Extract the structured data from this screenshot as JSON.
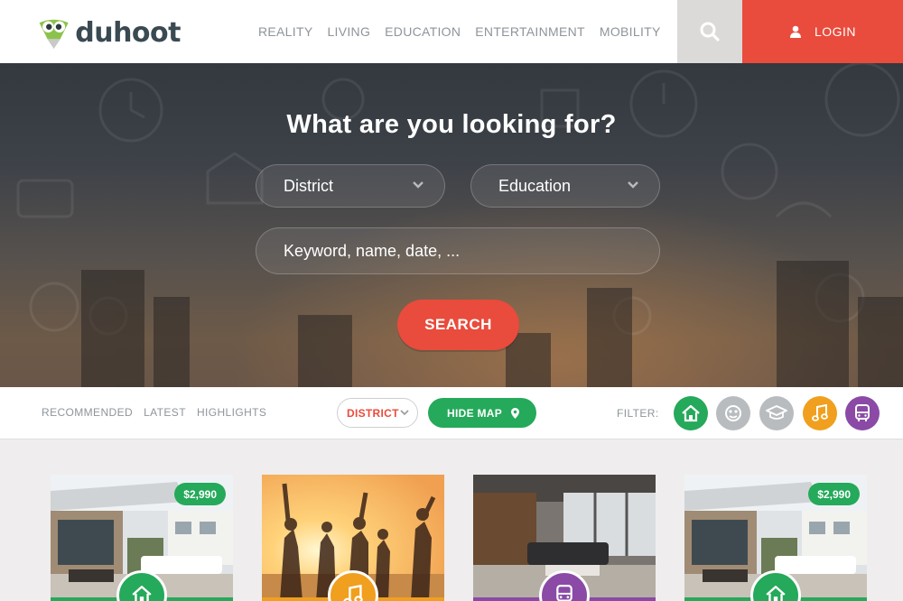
{
  "brand": {
    "name": "duhoot"
  },
  "nav": {
    "items": [
      "REALITY",
      "LIVING",
      "EDUCATION",
      "ENTERTAINMENT",
      "MOBILITY"
    ],
    "login_label": "LOGIN"
  },
  "hero": {
    "title": "What are you looking for?",
    "district_select": "District",
    "category_select": "Education",
    "keyword_placeholder": "Keyword, name, date, ...",
    "search_label": "SEARCH"
  },
  "filterbar": {
    "tabs": [
      "RECOMMENDED",
      "LATEST",
      "HIGHLIGHTS"
    ],
    "district_label": "DISTRICT",
    "hide_map_label": "HIDE MAP",
    "filter_label": "FILTER:",
    "filters": [
      {
        "icon": "home-icon",
        "color": "#25a95a",
        "active": true
      },
      {
        "icon": "mask-icon",
        "color": "#b8bcbf",
        "active": false
      },
      {
        "icon": "graduation-cap-icon",
        "color": "#b8bcbf",
        "active": false
      },
      {
        "icon": "music-note-icon",
        "color": "#f0a01e",
        "active": true
      },
      {
        "icon": "bus-icon",
        "color": "#8a4aa6",
        "active": true
      }
    ]
  },
  "cards": [
    {
      "category": "reality",
      "price": "$2,990",
      "color": "#25a95a",
      "icon": "home-icon"
    },
    {
      "category": "entertainment",
      "price": "",
      "color": "#f0a01e",
      "icon": "music-note-icon"
    },
    {
      "category": "mobility",
      "price": "",
      "color": "#8a4aa6",
      "icon": "bus-icon"
    },
    {
      "category": "reality",
      "price": "$2,990",
      "color": "#25a95a",
      "icon": "home-icon"
    }
  ],
  "colors": {
    "accent_red": "#e94b3c",
    "accent_green": "#25a95a",
    "accent_orange": "#f0a01e",
    "accent_purple": "#8a4aa6"
  }
}
